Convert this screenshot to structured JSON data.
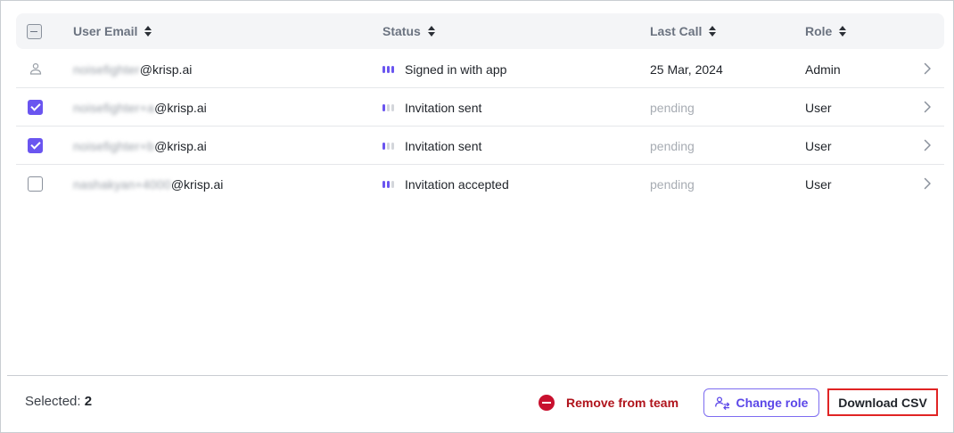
{
  "table": {
    "columns": [
      {
        "label": "User Email"
      },
      {
        "label": "Status"
      },
      {
        "label": "Last Call"
      },
      {
        "label": "Role"
      }
    ],
    "rows": [
      {
        "email_masked": "noisefighter",
        "email_domain": "@krisp.ai",
        "status": "Signed in with app",
        "status_level": 3,
        "last_call": "25 Mar, 2024",
        "role": "Admin",
        "selection": "self"
      },
      {
        "email_masked": "noisefighter+a",
        "email_domain": "@krisp.ai",
        "status": "Invitation sent",
        "status_level": 1,
        "last_call": "pending",
        "role": "User",
        "selection": "checked"
      },
      {
        "email_masked": "noisefighter+b",
        "email_domain": "@krisp.ai",
        "status": "Invitation sent",
        "status_level": 1,
        "last_call": "pending",
        "role": "User",
        "selection": "checked"
      },
      {
        "email_masked": "nashakyan+4000",
        "email_domain": "@krisp.ai",
        "status": "Invitation accepted",
        "status_level": 2,
        "last_call": "pending",
        "role": "User",
        "selection": "unchecked"
      }
    ]
  },
  "footer": {
    "selected_label": "Selected:",
    "selected_count": "2",
    "remove_label": "Remove from team",
    "change_role_label": "Change role",
    "download_label": "Download CSV"
  },
  "colors": {
    "accent": "#6a55f0",
    "danger": "#c8102e",
    "highlight_border": "#e02424"
  },
  "icons": {
    "sort": "sort-icon",
    "row_chevron": "chevron-right-icon",
    "self_user": "user-icon",
    "remove": "minus-circle-icon",
    "change_role": "users-switch-icon"
  }
}
